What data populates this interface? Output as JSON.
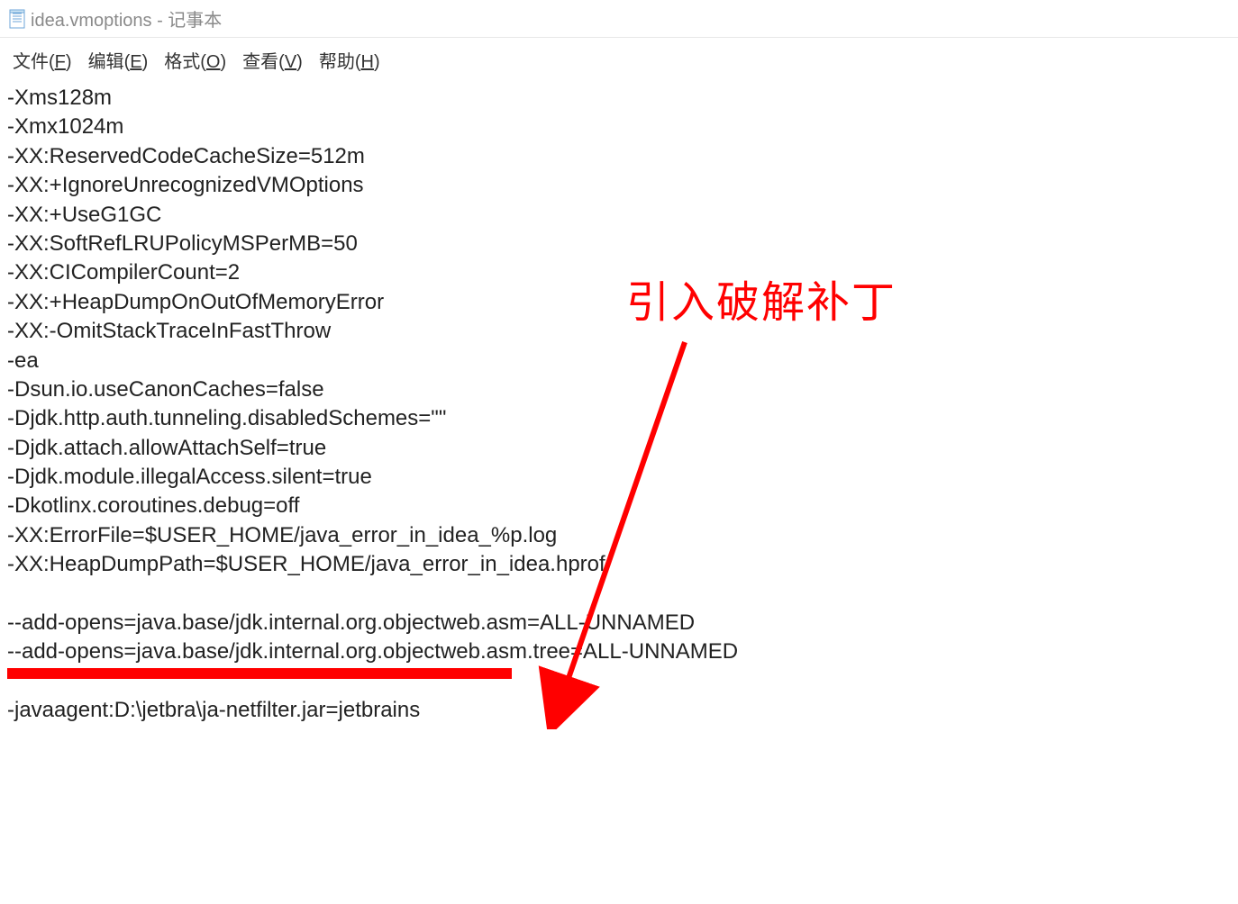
{
  "window": {
    "title": "idea.vmoptions - 记事本"
  },
  "menu": {
    "file": {
      "label": "文件",
      "accelerator": "F"
    },
    "edit": {
      "label": "编辑",
      "accelerator": "E"
    },
    "format": {
      "label": "格式",
      "accelerator": "O"
    },
    "view": {
      "label": "查看",
      "accelerator": "V"
    },
    "help": {
      "label": "帮助",
      "accelerator": "H"
    }
  },
  "content": {
    "lines": [
      "-Xms128m",
      "-Xmx1024m",
      "-XX:ReservedCodeCacheSize=512m",
      "-XX:+IgnoreUnrecognizedVMOptions",
      "-XX:+UseG1GC",
      "-XX:SoftRefLRUPolicyMSPerMB=50",
      "-XX:CICompilerCount=2",
      "-XX:+HeapDumpOnOutOfMemoryError",
      "-XX:-OmitStackTraceInFastThrow",
      "-ea",
      "-Dsun.io.useCanonCaches=false",
      "-Djdk.http.auth.tunneling.disabledSchemes=\"\"",
      "-Djdk.attach.allowAttachSelf=true",
      "-Djdk.module.illegalAccess.silent=true",
      "-Dkotlinx.coroutines.debug=off",
      "-XX:ErrorFile=$USER_HOME/java_error_in_idea_%p.log",
      "-XX:HeapDumpPath=$USER_HOME/java_error_in_idea.hprof",
      "",
      "--add-opens=java.base/jdk.internal.org.objectweb.asm=ALL-UNNAMED",
      "--add-opens=java.base/jdk.internal.org.objectweb.asm.tree=ALL-UNNAMED",
      "",
      "-javaagent:D:\\jetbra\\ja-netfilter.jar=jetbrains"
    ]
  },
  "annotation": {
    "text": "引入破解补丁"
  }
}
